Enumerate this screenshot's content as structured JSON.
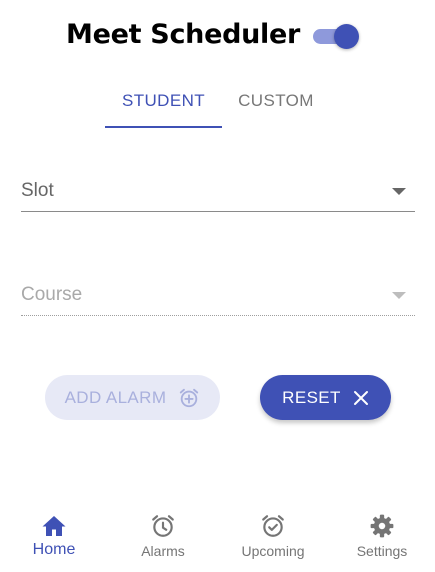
{
  "header": {
    "title": "Meet Scheduler",
    "toggle": {
      "state": "on",
      "accent": "#3f51b5"
    }
  },
  "tabs": [
    {
      "label": "STUDENT",
      "selected": true
    },
    {
      "label": "CUSTOM",
      "selected": false
    }
  ],
  "form": {
    "slot": {
      "label": "Slot",
      "icon": "arrow-drop-down-icon"
    },
    "course": {
      "label": "Course",
      "icon": "arrow-drop-down-icon",
      "disabled": true
    }
  },
  "actions": {
    "add_alarm": {
      "label": "ADD ALARM",
      "icon": "add-alarm-icon",
      "disabled": true
    },
    "reset": {
      "label": "RESET",
      "icon": "close-icon"
    }
  },
  "bottom_nav": {
    "items": [
      {
        "label": "Home",
        "icon": "home-icon",
        "selected": true
      },
      {
        "label": "Alarms",
        "icon": "alarm-icon"
      },
      {
        "label": "Upcoming",
        "icon": "alarm-on-icon"
      },
      {
        "label": "Settings",
        "icon": "gear-icon"
      }
    ]
  },
  "colors": {
    "primary": "#3f51b5",
    "primary_light": "#8e99db",
    "disabled_bg": "#e7e9f6",
    "disabled_text": "#a9b0dd",
    "inactive": "#757575"
  }
}
